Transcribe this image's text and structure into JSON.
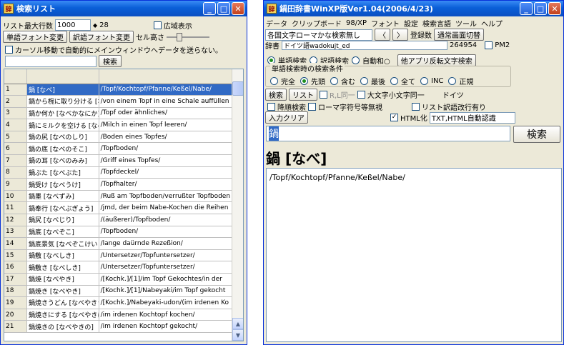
{
  "left_window": {
    "title": "検索リスト",
    "max_rows_label": "リスト最大行数",
    "max_rows_value": "1000",
    "count": "28",
    "wide_display_label": "広域表示",
    "word_font_button": "単語フォント変更",
    "trans_font_button": "訳語フォント変更",
    "cell_height_label": "セル高さ",
    "cursor_move_label": "カーソル移動で自動的にメインウィンドウへデータを送らない。",
    "search_button": "検索",
    "rows": [
      {
        "n": "1",
        "word": "鍋 [なべ]",
        "trans": "/Topf/Kochtopf/Pfanne/Keßel/Nabe/"
      },
      {
        "n": "2",
        "word": "鍋から椀に取り分ける [な",
        "trans": "/von einem Topf in eine Schale auffüllen"
      },
      {
        "n": "3",
        "word": "鍋か何か [なべかなにか]",
        "trans": "/Topf oder ähnliches/"
      },
      {
        "n": "4",
        "word": "鍋にミルクを空ける [なべ",
        "trans": "/Milch in einen Topf leeren/"
      },
      {
        "n": "5",
        "word": "鍋の尻 [なべのしり]",
        "trans": "/Boden eines Topfes/"
      },
      {
        "n": "6",
        "word": "鍋の底 [なべのそこ]",
        "trans": "/Topfboden/"
      },
      {
        "n": "7",
        "word": "鍋の耳 [なべのみみ]",
        "trans": "/Griff eines Topfes/"
      },
      {
        "n": "8",
        "word": "鍋ぶた [なべぶた]",
        "trans": "/Topfdeckel/"
      },
      {
        "n": "9",
        "word": "鍋受け [なべうけ]",
        "trans": "/Topfhalter/"
      },
      {
        "n": "10",
        "word": "鍋墨 [なべずみ]",
        "trans": "/Ruß am Topfboden/verrußter Topfboden"
      },
      {
        "n": "11",
        "word": "鍋奉行 [なべぶぎょう]",
        "trans": "/jmd, der beim Nabe-Kochen die Reihen"
      },
      {
        "n": "12",
        "word": "鍋尻 [なべじり]",
        "trans": "/(äußerer)/Topfboden/"
      },
      {
        "n": "13",
        "word": "鍋底 [なべぞこ]",
        "trans": "/Topfboden/"
      },
      {
        "n": "14",
        "word": "鍋底景気 [なべぞこけい",
        "trans": "/lange daürnde Rezeßion/"
      },
      {
        "n": "15",
        "word": "鍋敷 [なべしき]",
        "trans": "/Untersetzer/Topfuntersetzer/"
      },
      {
        "n": "16",
        "word": "鍋敷き [なべしき]",
        "trans": "/Untersetzer/Topfuntersetzer/"
      },
      {
        "n": "17",
        "word": "鍋焼 [なべやき]",
        "trans": "/[Kochk.]/[1]/im Topf Gekochtes/in der"
      },
      {
        "n": "18",
        "word": "鍋焼き [なべやき]",
        "trans": "/[Kochk.]/[1]/Nabeyaki/im Topf gekocht"
      },
      {
        "n": "19",
        "word": "鍋焼きうどん [なべやきう",
        "trans": "/[Kochk.]/Nabeyaki-udon/(im irdenen Ko"
      },
      {
        "n": "20",
        "word": "鍋焼きにする [なべやきに",
        "trans": "/im irdenen Kochtopf kochen/"
      },
      {
        "n": "21",
        "word": "鍋焼きの [なべやきの]",
        "trans": "/im irdenen Kochtopf gekocht/"
      }
    ]
  },
  "right_window": {
    "title": "鍋田辞書WinXP版Ver1.04(2006/4/23)",
    "menu": [
      "データ",
      "クリップボード",
      "98/XP",
      "フォント",
      "設定",
      "検索言語",
      "ツール",
      "ヘルプ"
    ],
    "conversion_select": "各国文字ローマかな検索無し",
    "registered_label": "登録数",
    "registered_count": "264954",
    "normal_switch_button": "通常画面切替",
    "pm2_label": "PM2",
    "dict_label": "辞書",
    "dict_value": "ドイツ語wadokujt_ed",
    "reverse_search_button": "他アプリ反転文字検索",
    "search_mode": [
      "単語検索",
      "訳語検索",
      "自動和○"
    ],
    "condition_label": "単語検索時の検索条件",
    "conditions": [
      "完全",
      "先頭",
      "含む",
      "最後",
      "全て",
      "INC",
      "正規"
    ],
    "search_button": "検索",
    "list_button": "リスト",
    "r_l_same_label": "R,L同一",
    "case_label": "大文字小文字同一",
    "lang_label": "ドイツ",
    "desc_search_label": "降順検索",
    "roma_label": "ローマ字符号等無視",
    "list_newline_label": "リスト訳語改行有り",
    "input_clear_button": "入力クリア",
    "html_label": "HTML化",
    "html_select": "TXT,HTML自動認識",
    "query": "鍋",
    "main_search_button": "検索",
    "headword": "鍋 [なべ]",
    "translation": "/Topf/Kochtopf/Pfanne/Keßel/Nabe/"
  },
  "colors": {
    "titlebar": "#0a5fd8",
    "selection": "#316ac5",
    "window_bg": "#ece9d8"
  }
}
